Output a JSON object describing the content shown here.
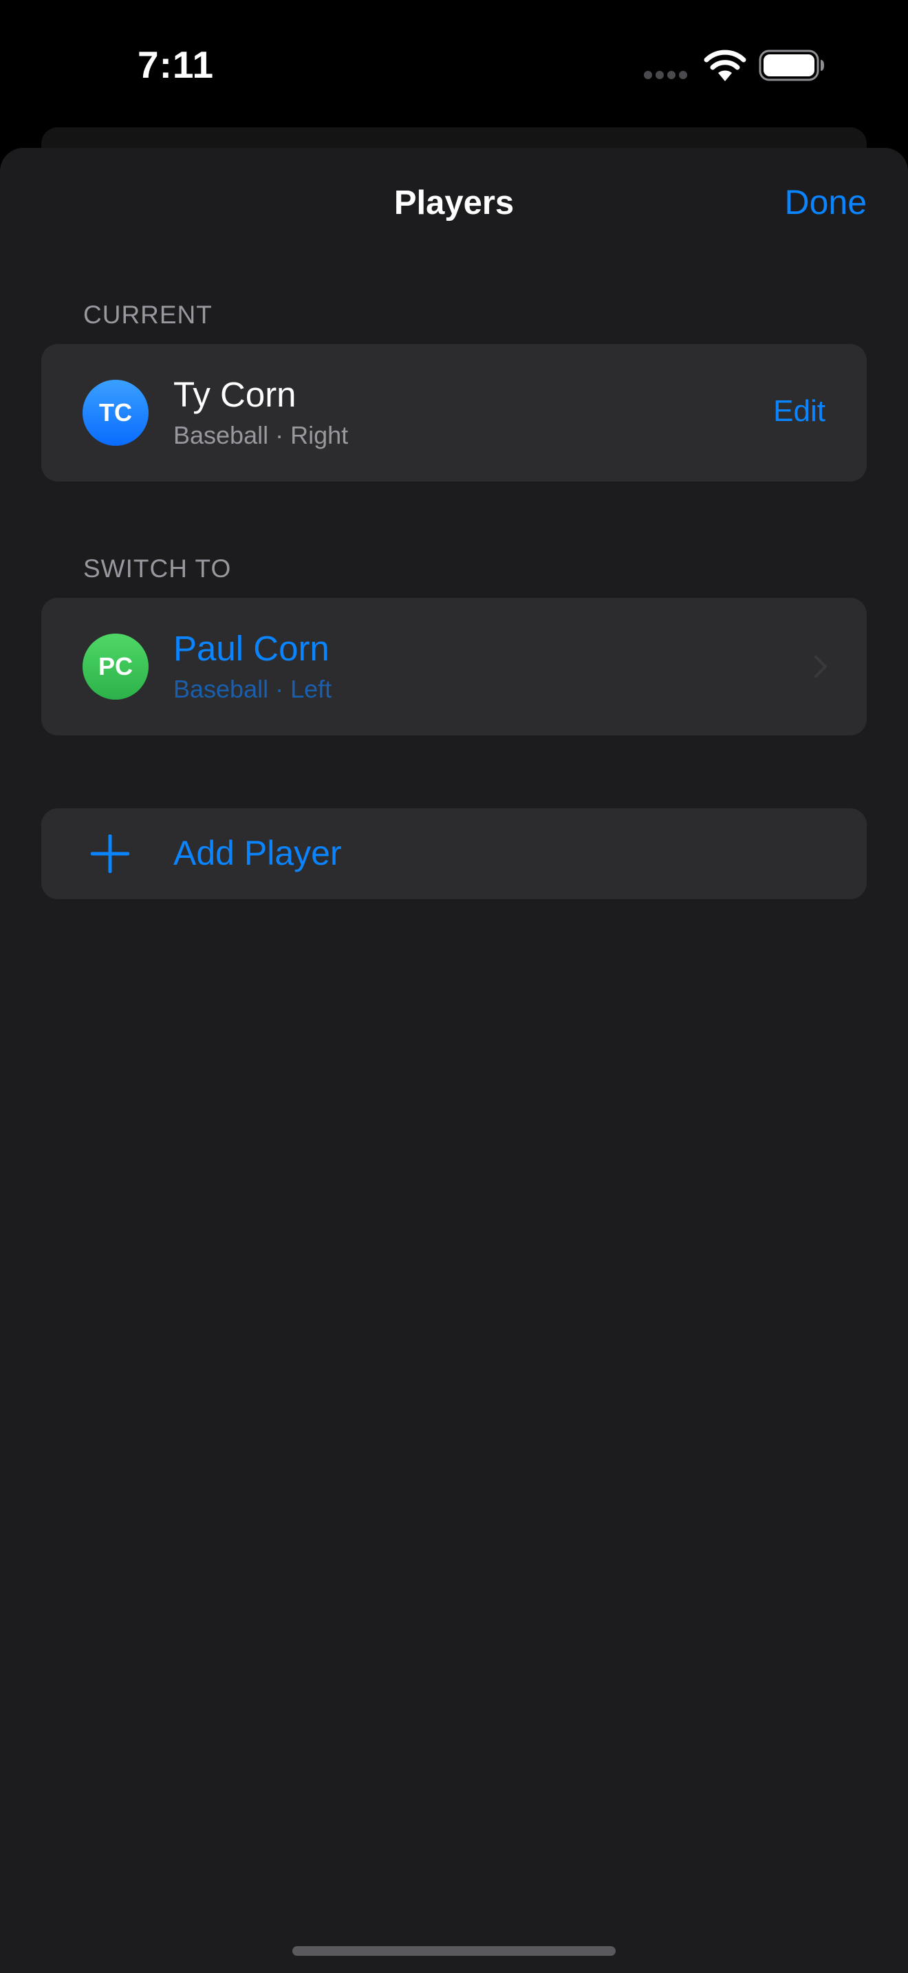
{
  "status_bar": {
    "time": "7:11"
  },
  "nav": {
    "title": "Players",
    "done_label": "Done"
  },
  "current": {
    "header": "CURRENT",
    "player": {
      "initials": "TC",
      "name": "Ty Corn",
      "subtitle": "Baseball · Right",
      "edit_label": "Edit"
    }
  },
  "switch_to": {
    "header": "SWITCH TO",
    "players": [
      {
        "initials": "PC",
        "name": "Paul Corn",
        "subtitle": "Baseball · Left"
      }
    ]
  },
  "add_player": {
    "label": "Add Player"
  },
  "icons": {
    "wifi": "wifi-icon",
    "battery": "battery-icon",
    "chevron": "chevron-right-icon",
    "plus": "plus-icon"
  },
  "colors": {
    "accent": "#0a84ff",
    "sheet_background": "#1c1c1e",
    "group_background": "#2c2c2e",
    "secondary_text": "#98989f",
    "avatar_current": "#0a84ff",
    "avatar_switch": "#34c759"
  }
}
